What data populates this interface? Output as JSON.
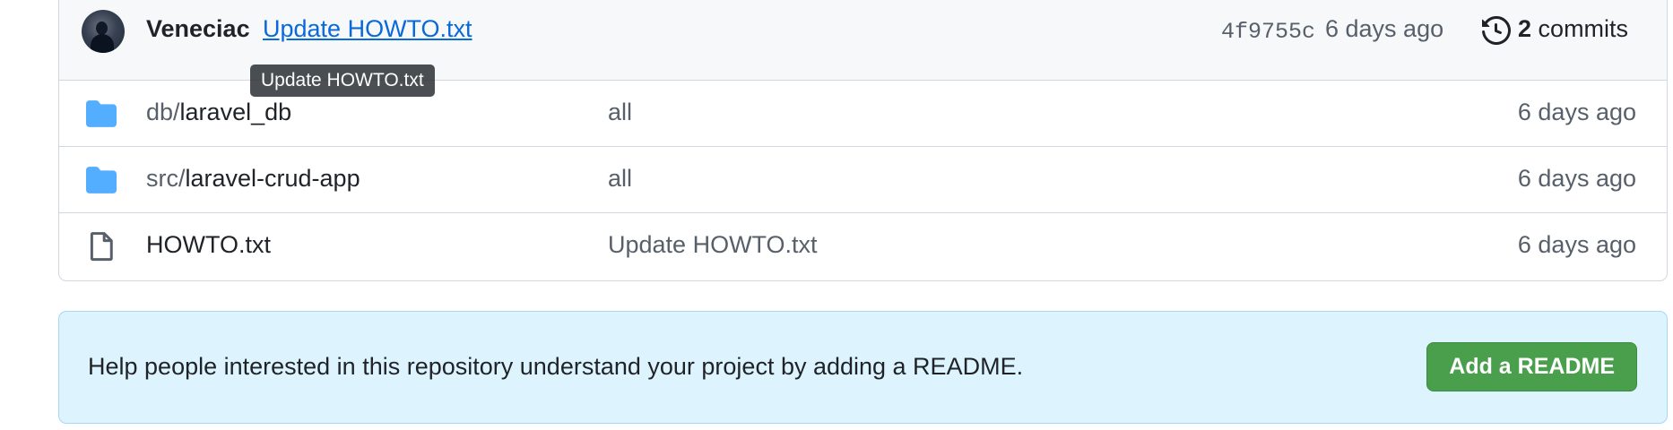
{
  "latest_commit": {
    "author": "Veneciac",
    "message": "Update HOWTO.txt",
    "hash": "4f9755c",
    "time": "6 days ago",
    "commit_count": "2",
    "commits_label": "commits",
    "avatar_icon": "user-avatar",
    "history_icon": "history-icon"
  },
  "tooltip": {
    "text": "Update HOWTO.txt"
  },
  "files": [
    {
      "type": "directory",
      "icon": "folder-icon",
      "prefix": "db/",
      "name": "laravel_db",
      "commit_message": "all",
      "time": "6 days ago"
    },
    {
      "type": "directory",
      "icon": "folder-icon",
      "prefix": "src/",
      "name": "laravel-crud-app",
      "commit_message": "all",
      "time": "6 days ago"
    },
    {
      "type": "file",
      "icon": "file-icon",
      "prefix": "",
      "name": "HOWTO.txt",
      "commit_message": "Update HOWTO.txt",
      "time": "6 days ago"
    }
  ],
  "readme_banner": {
    "text": "Help people interested in this repository understand your project by adding a README.",
    "button_label": "Add a README"
  },
  "colors": {
    "link": "#0969da",
    "folder": "#54aeff",
    "banner_bg": "#ddf4ff",
    "button_bg": "#4a9f4d"
  }
}
